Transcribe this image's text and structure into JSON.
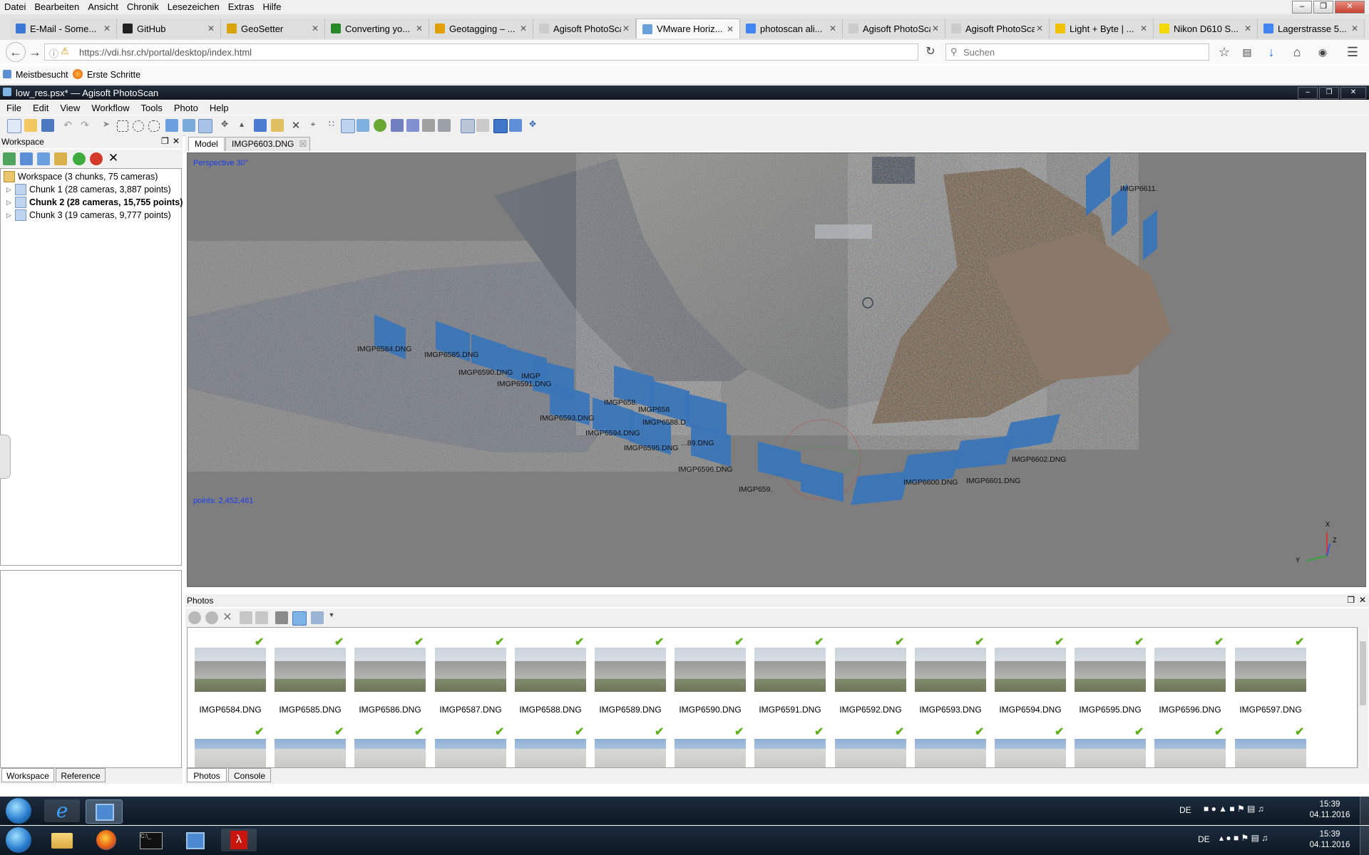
{
  "firefox": {
    "menu": [
      "Datei",
      "Bearbeiten",
      "Ansicht",
      "Chronik",
      "Lesezeichen",
      "Extras",
      "Hilfe"
    ],
    "tabs": [
      {
        "title": "E-Mail - Some...",
        "color": "#3b78d8"
      },
      {
        "title": "GitHub",
        "color": "#222222"
      },
      {
        "title": "GeoSetter",
        "color": "#d9a300"
      },
      {
        "title": "Converting yo...",
        "color": "#2a8a2a"
      },
      {
        "title": "Geotagging – ...",
        "color": "#e0a000"
      },
      {
        "title": "Agisoft PhotoSca...",
        "color": "#cccccc"
      },
      {
        "title": "VMware Horiz...",
        "color": "#6aa0d8"
      },
      {
        "title": "photoscan ali...",
        "color": "#4285f4"
      },
      {
        "title": "Agisoft PhotoSca...",
        "color": "#cccccc"
      },
      {
        "title": "Agisoft PhotoSca...",
        "color": "#cccccc"
      },
      {
        "title": "Light + Byte | ...",
        "color": "#f2c200"
      },
      {
        "title": "Nikon D610 S...",
        "color": "#f5d800"
      },
      {
        "title": "Lagerstrasse 5...",
        "color": "#4285f4"
      }
    ],
    "url": "https://vdi.hsr.ch/portal/desktop/index.html",
    "search_placeholder": "Suchen",
    "bookmarks": [
      "Meistbesucht",
      "Erste Schritte"
    ]
  },
  "photoscan": {
    "title": "low_res.psx* — Agisoft PhotoScan",
    "menu": [
      "File",
      "Edit",
      "View",
      "Workflow",
      "Tools",
      "Photo",
      "Help"
    ],
    "workspace": {
      "header": "Workspace",
      "root": "Workspace (3 chunks, 75 cameras)",
      "chunks": [
        "Chunk 1 (28 cameras, 3,887 points)",
        "Chunk 2 (28 cameras, 15,755 points)",
        "Chunk 3 (19 cameras, 9,777 points)"
      ],
      "bottom_tabs": [
        "Workspace",
        "Reference"
      ]
    },
    "view_tabs": [
      "Model",
      "IMGP6603.DNG"
    ],
    "viewport": {
      "projection": "Perspective 30°",
      "points": "points: 2,452,461",
      "camera_labels": [
        "IMGP6584.DNG",
        "IMGP6585.DNG",
        "IMGP6590.DNG",
        "IMGP6591.DNG",
        "IMGP6593.DNG",
        "IMGP6594.DNG",
        "IMGP6595.DNG",
        "IMGP6596.DNG",
        "IMGP659.",
        "IMGP6600.DNG",
        "IMGP6601.DNG",
        "IMGP6602.DNG",
        "IMGP6611.",
        "IMGP",
        "IMGP658.",
        "IMGP6588.D",
        "IMGP658",
        "...89.DNG"
      ],
      "axes": [
        "X",
        "Y",
        "Z"
      ]
    },
    "photos": {
      "header": "Photos",
      "files": [
        "IMGP6584.DNG",
        "IMGP6585.DNG",
        "IMGP6586.DNG",
        "IMGP6587.DNG",
        "IMGP6588.DNG",
        "IMGP6589.DNG",
        "IMGP6590.DNG",
        "IMGP6591.DNG",
        "IMGP6592.DNG",
        "IMGP6593.DNG",
        "IMGP6594.DNG",
        "IMGP6595.DNG",
        "IMGP6596.DNG",
        "IMGP6597.DNG"
      ],
      "bottom_tabs": [
        "Photos",
        "Console"
      ]
    }
  },
  "taskbar": {
    "time": "15:39",
    "date": "04.11.2016",
    "lang": "DE"
  },
  "colors": {
    "camera": "#3a75b8",
    "viewport_bg": "#7e7e7e",
    "check": "#5fae1c"
  }
}
